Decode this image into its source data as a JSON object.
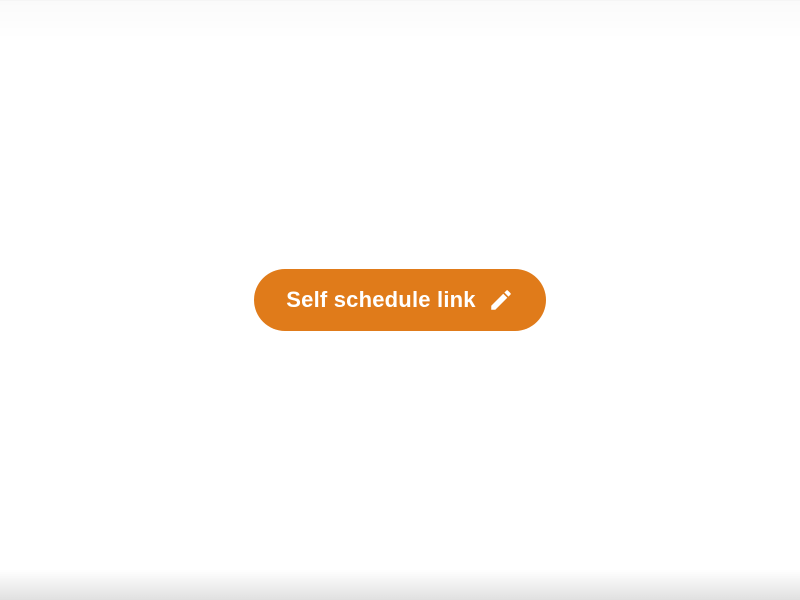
{
  "button": {
    "label": "Self schedule link",
    "icon": "pencil-icon",
    "color": "#E07B1A"
  }
}
